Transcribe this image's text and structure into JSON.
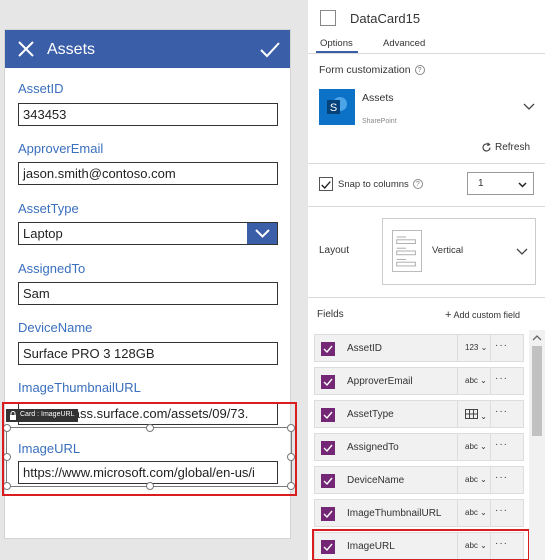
{
  "form": {
    "title": "Assets",
    "fields": [
      {
        "label": "AssetID",
        "value": "343453"
      },
      {
        "label": "ApproverEmail",
        "value": "jason.smith@contoso.com"
      },
      {
        "label": "AssetType",
        "value": "Laptop"
      },
      {
        "label": "AssignedTo",
        "value": "Sam"
      },
      {
        "label": "DeviceName",
        "value": "Surface PRO 3 128GB"
      },
      {
        "label": "ImageThumbnailURL",
        "value": "compass.surface.com/assets/09/73."
      },
      {
        "label": "ImageURL",
        "value": "https://www.microsoft.com/global/en-us/i"
      }
    ],
    "card_tag": "Card : ImageURL"
  },
  "panel": {
    "card_name": "DataCard15",
    "tabs": [
      "Options",
      "Advanced"
    ],
    "active_tab": "Options",
    "form_customization": "Form customization",
    "data_source": {
      "name": "Assets",
      "type": "SharePoint",
      "logo_letter": "S"
    },
    "refresh": "Refresh",
    "snap_to_columns": "Snap to columns",
    "snap_checked": true,
    "columns_value": "1",
    "layout_label": "Layout",
    "layout_value": "Vertical",
    "fields_label": "Fields",
    "add_custom_field": "Add custom field",
    "field_rows": [
      {
        "name": "AssetID",
        "type": "123"
      },
      {
        "name": "ApproverEmail",
        "type": "abc"
      },
      {
        "name": "AssetType",
        "type": "grid"
      },
      {
        "name": "AssignedTo",
        "type": "abc"
      },
      {
        "name": "DeviceName",
        "type": "abc"
      },
      {
        "name": "ImageThumbnailURL",
        "type": "abc"
      },
      {
        "name": "ImageURL",
        "type": "abc"
      }
    ],
    "more_glyph": "···"
  },
  "colors": {
    "title_bar": "#3a5ea8",
    "field_label": "#3a6fbf",
    "checkbox_purple": "#742774",
    "highlight_red": "#d81e1e",
    "sharepoint_blue": "#0b72c8"
  },
  "icons": [
    "close-icon",
    "check-icon",
    "chevron-down-icon",
    "lock-icon",
    "info-icon",
    "refresh-icon",
    "add-icon",
    "grid-icon",
    "sharepoint-logo",
    "more-icon"
  ]
}
